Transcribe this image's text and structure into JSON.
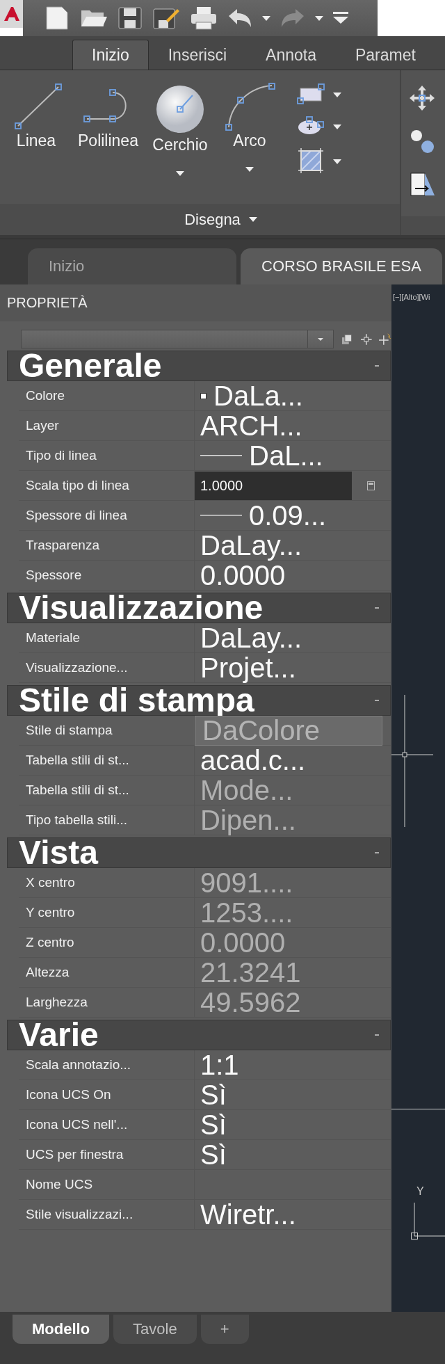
{
  "ribbon": {
    "tabs": [
      {
        "label": "Inizio",
        "selected": true
      },
      {
        "label": "Inserisci",
        "selected": false
      },
      {
        "label": "Annota",
        "selected": false
      },
      {
        "label": "Paramet",
        "selected": false
      }
    ],
    "tools": [
      {
        "label": "Linea",
        "kind": "line",
        "dropdown": false
      },
      {
        "label": "Polilinea",
        "kind": "polyline",
        "dropdown": false
      },
      {
        "label": "Cerchio",
        "kind": "circle",
        "dropdown": true
      },
      {
        "label": "Arco",
        "kind": "arc",
        "dropdown": true
      }
    ],
    "small_tools": [
      {
        "kind": "rectangle",
        "dropdown": true
      },
      {
        "kind": "ellipse",
        "dropdown": true
      },
      {
        "kind": "hatch",
        "dropdown": true
      }
    ],
    "panel_title": "Disegna"
  },
  "file_tabs": [
    {
      "label": "Inizio",
      "selected": false
    },
    {
      "label": "CORSO BRASILE ESA",
      "selected": true
    }
  ],
  "properties": {
    "title": "PROPRIETÀ",
    "sections": [
      {
        "title": "Generale",
        "expanded": true,
        "rows": [
          {
            "label": "Colore",
            "value": "DaLa...",
            "kind": "swatch",
            "disabled": false
          },
          {
            "label": "Layer",
            "value": "ARCH...",
            "kind": "text",
            "disabled": false
          },
          {
            "label": "Tipo di linea",
            "value": "DaL...",
            "kind": "linetype",
            "disabled": false
          },
          {
            "label": "Scala tipo di linea",
            "value": "1.0000",
            "kind": "input",
            "disabled": false
          },
          {
            "label": "Spessore di linea",
            "value": "0.09...",
            "kind": "linetype",
            "disabled": false
          },
          {
            "label": "Trasparenza",
            "value": "DaLay...",
            "kind": "text",
            "disabled": false
          },
          {
            "label": "Spessore",
            "value": "0.0000",
            "kind": "text",
            "disabled": false
          }
        ]
      },
      {
        "title": "Visualizzazione",
        "expanded": true,
        "rows": [
          {
            "label": "Materiale",
            "value": "DaLay...",
            "kind": "text",
            "disabled": false
          },
          {
            "label": "Visualizzazione...",
            "value": "Projet...",
            "kind": "text",
            "disabled": false
          }
        ]
      },
      {
        "title": "Stile di stampa",
        "expanded": true,
        "rows": [
          {
            "label": "Stile di stampa",
            "value": "DaColore",
            "kind": "box",
            "disabled": true
          },
          {
            "label": "Tabella stili di st...",
            "value": "acad.c...",
            "kind": "text",
            "disabled": false
          },
          {
            "label": "Tabella stili di st...",
            "value": "Mode...",
            "kind": "text",
            "disabled": true
          },
          {
            "label": "Tipo tabella stili...",
            "value": "Dipen...",
            "kind": "text",
            "disabled": true
          }
        ]
      },
      {
        "title": "Vista",
        "expanded": true,
        "rows": [
          {
            "label": "X centro",
            "value": "9091....",
            "kind": "text",
            "disabled": true
          },
          {
            "label": "Y centro",
            "value": "1253....",
            "kind": "text",
            "disabled": true
          },
          {
            "label": "Z centro",
            "value": "0.0000",
            "kind": "text",
            "disabled": true
          },
          {
            "label": "Altezza",
            "value": "21.3241",
            "kind": "text",
            "disabled": true
          },
          {
            "label": "Larghezza",
            "value": "49.5962",
            "kind": "text",
            "disabled": true
          }
        ]
      },
      {
        "title": "Varie",
        "expanded": true,
        "rows": [
          {
            "label": "Scala annotazio...",
            "value": "1:1",
            "kind": "text",
            "disabled": false
          },
          {
            "label": "Icona UCS On",
            "value": "Sì",
            "kind": "text",
            "disabled": false
          },
          {
            "label": "Icona UCS nell'...",
            "value": "Sì",
            "kind": "text",
            "disabled": false
          },
          {
            "label": "UCS per finestra",
            "value": "Sì",
            "kind": "text",
            "disabled": false
          },
          {
            "label": "Nome UCS",
            "kind": "text"
          },
          {
            "label": "Stile visualizzazi...",
            "value": "Wiretr...",
            "kind": "text",
            "disabled": false
          }
        ]
      }
    ]
  },
  "viewport": {
    "label": "[−][Alto][Wi",
    "axis_label": "Y"
  },
  "layout_tabs": [
    {
      "label": "Modello",
      "selected": true
    },
    {
      "label": "Tavole",
      "selected": false
    },
    {
      "label": "+",
      "selected": false
    }
  ]
}
